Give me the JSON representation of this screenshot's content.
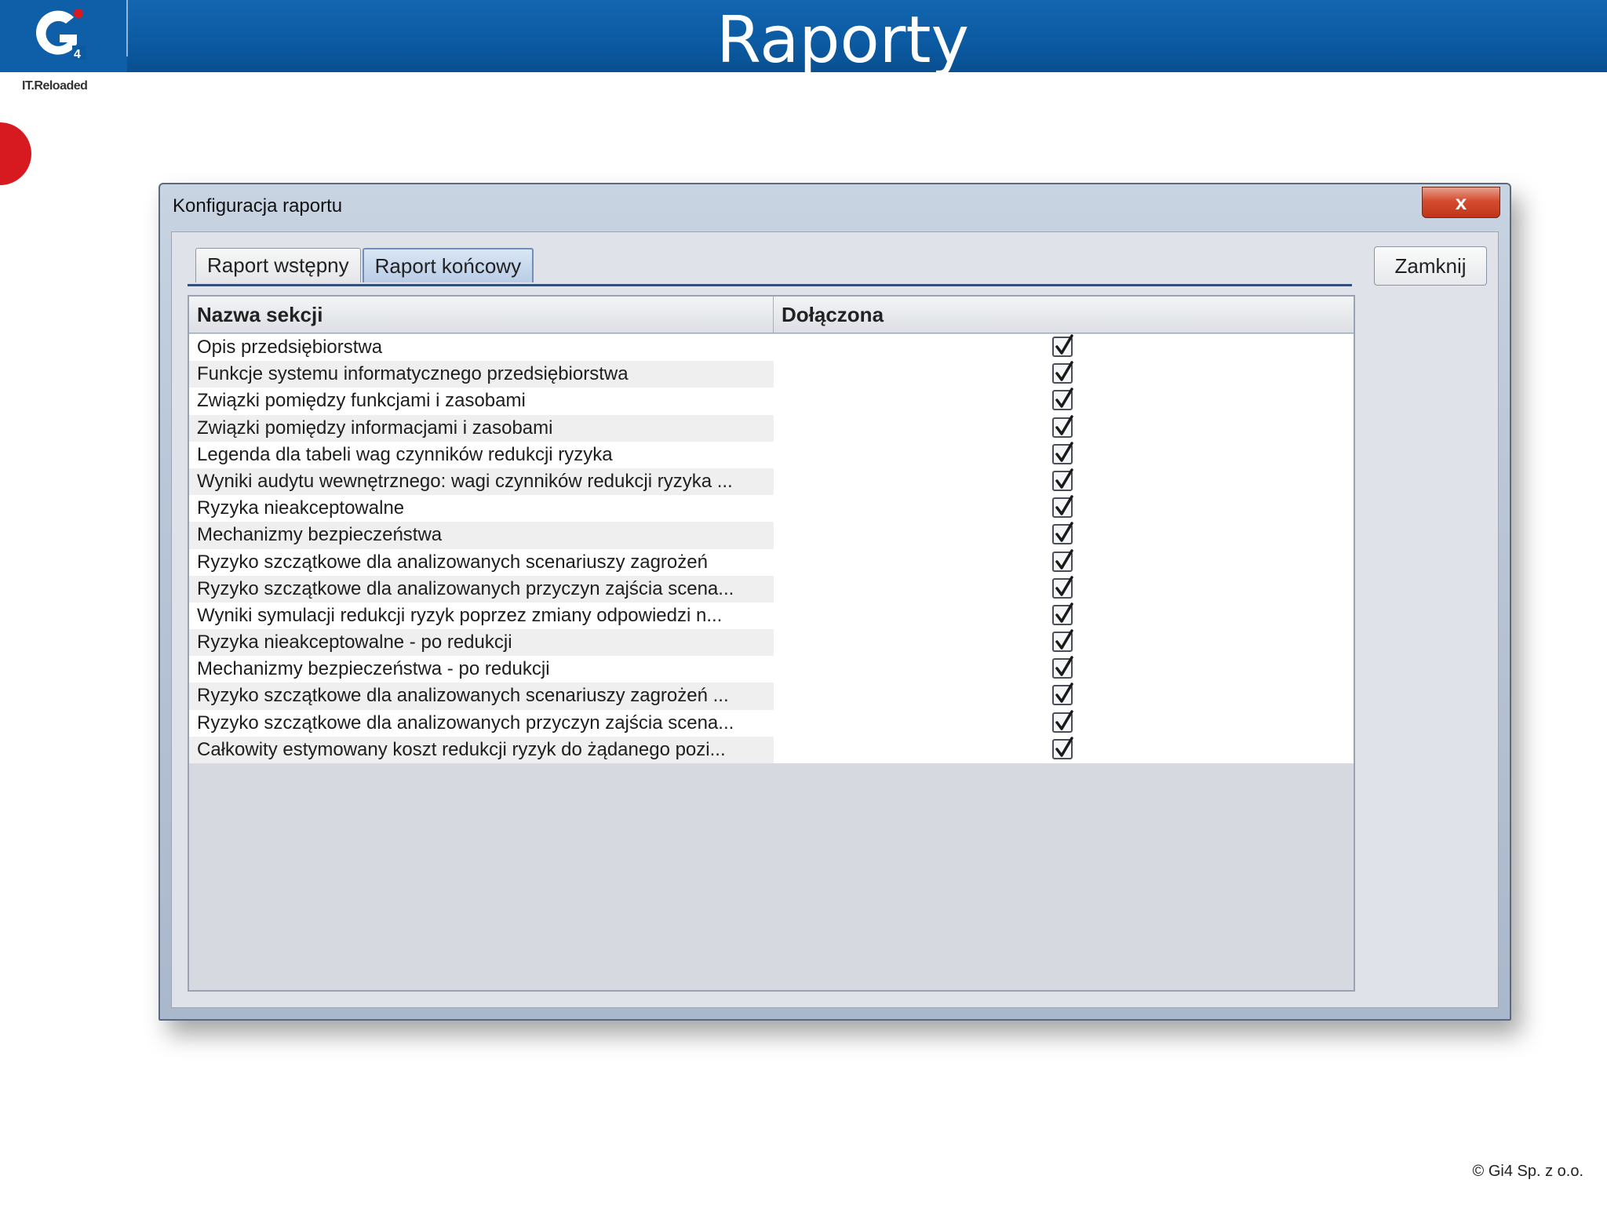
{
  "slide": {
    "title": "Raporty",
    "logo_tagline": "IT.Reloaded",
    "copyright": "© Gi4 Sp. z o.o."
  },
  "dialog": {
    "title": "Konfiguracja raportu",
    "close_label": "x",
    "close_button": "Zamknij",
    "tabs": [
      {
        "label": "Raport wstępny",
        "active": false
      },
      {
        "label": "Raport końcowy",
        "active": true
      }
    ],
    "table": {
      "columns": [
        "Nazwa sekcji",
        "Dołączona"
      ],
      "rows": [
        {
          "name": "Opis przedsiębiorstwa",
          "included": true
        },
        {
          "name": "Funkcje systemu informatycznego przedsiębiorstwa",
          "included": true
        },
        {
          "name": "Związki pomiędzy funkcjami i zasobami",
          "included": true
        },
        {
          "name": "Związki pomiędzy informacjami i zasobami",
          "included": true
        },
        {
          "name": "Legenda dla tabeli wag czynników redukcji ryzyka",
          "included": true
        },
        {
          "name": "Wyniki audytu wewnętrznego: wagi czynników redukcji ryzyka ...",
          "included": true
        },
        {
          "name": "Ryzyka nieakceptowalne",
          "included": true
        },
        {
          "name": "Mechanizmy bezpieczeństwa",
          "included": true
        },
        {
          "name": "Ryzyko szczątkowe dla analizowanych scenariuszy zagrożeń",
          "included": true
        },
        {
          "name": "Ryzyko szczątkowe dla analizowanych przyczyn zajścia scena...",
          "included": true
        },
        {
          "name": "Wyniki symulacji redukcji ryzyk poprzez zmiany odpowiedzi n...",
          "included": true
        },
        {
          "name": "Ryzyka nieakceptowalne - po redukcji",
          "included": true
        },
        {
          "name": "Mechanizmy bezpieczeństwa - po redukcji",
          "included": true
        },
        {
          "name": "Ryzyko szczątkowe dla analizowanych scenariuszy zagrożeń ...",
          "included": true
        },
        {
          "name": "Ryzyko szczątkowe dla analizowanych przyczyn zajścia scena...",
          "included": true
        },
        {
          "name": "Całkowity estymowany koszt redukcji ryzyk do żądanego pozi...",
          "included": true
        }
      ]
    }
  },
  "colors": {
    "banner_blue": "#0b5aa2",
    "accent_red": "#d71920",
    "active_tab": "#b9cde6"
  },
  "icons": [
    "checkbox-checked-icon",
    "close-icon",
    "g4-logo"
  ]
}
